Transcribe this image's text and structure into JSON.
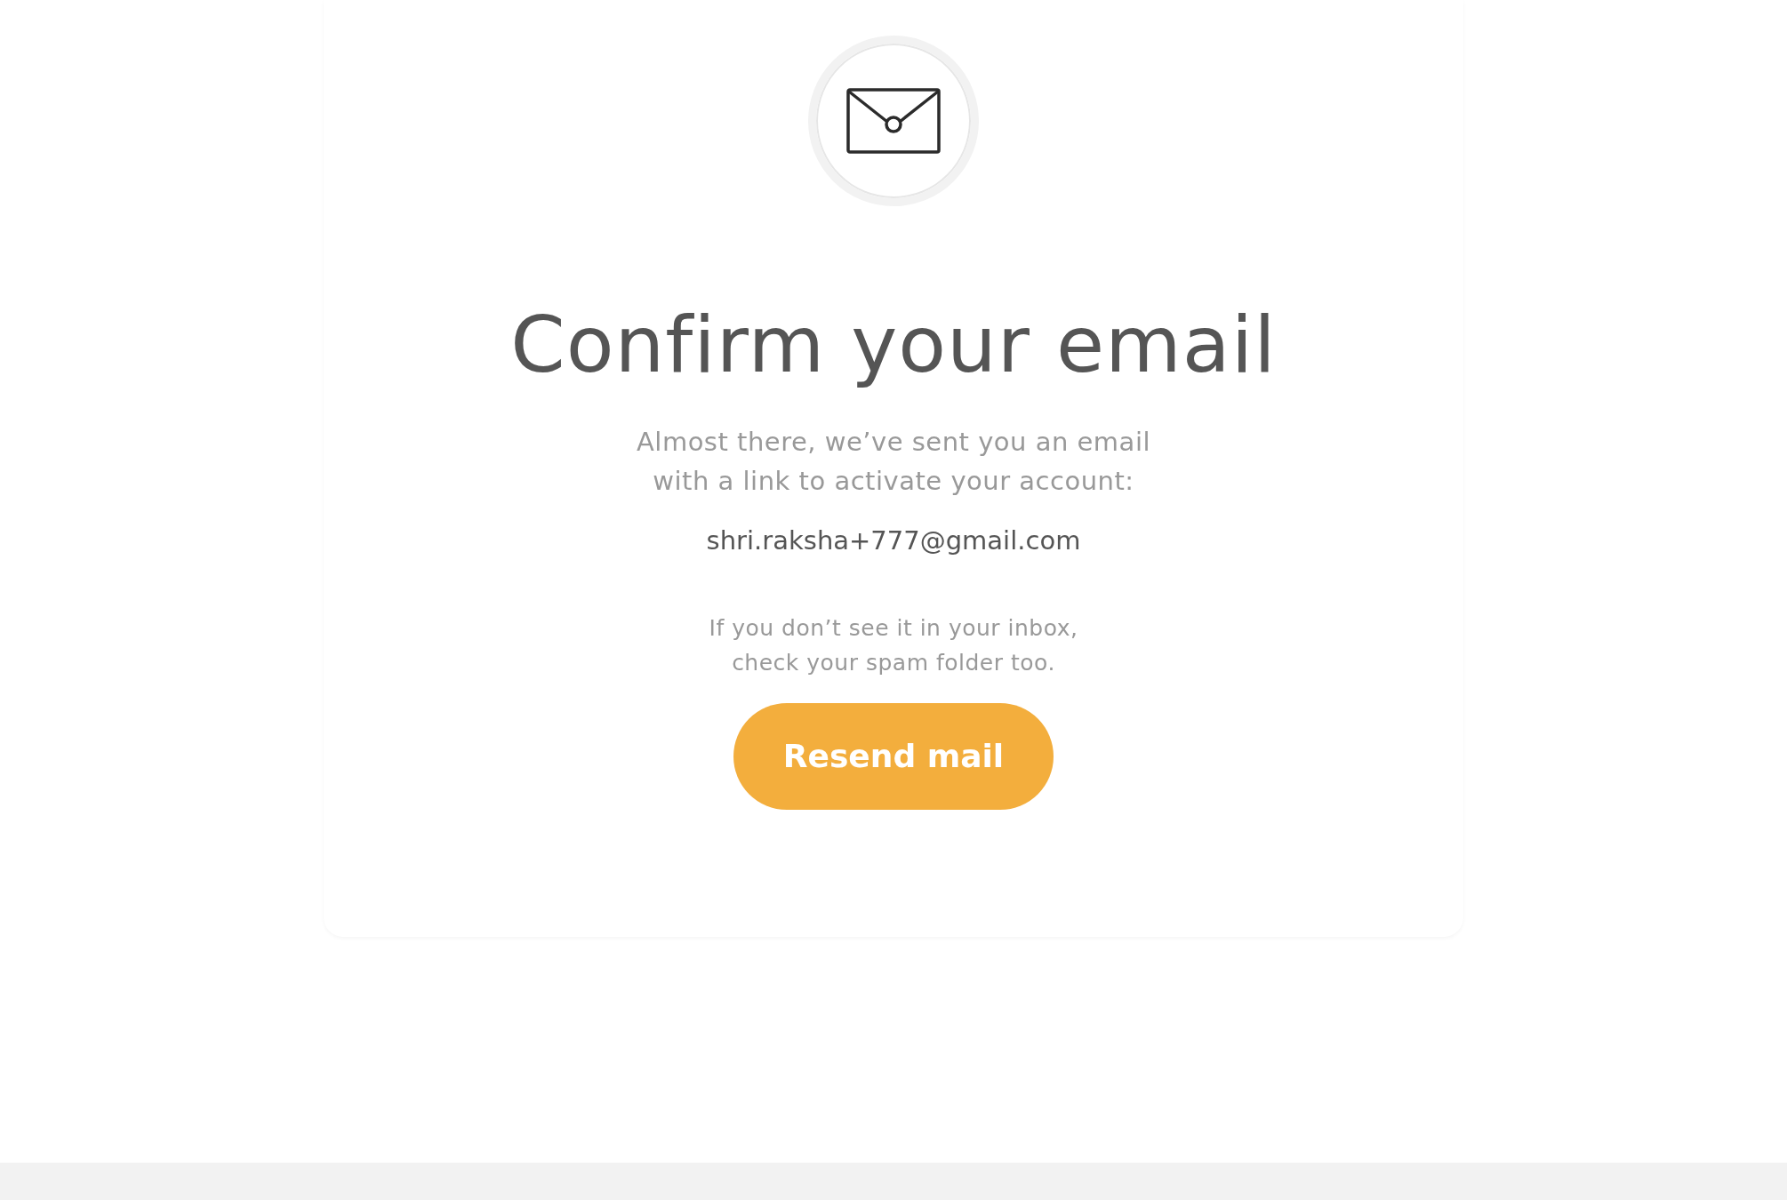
{
  "title": "Confirm your email",
  "message": [
    "Almost there, we’ve sent you an email",
    "with a link to activate your account:"
  ],
  "email": "shri.raksha+777@gmail.com",
  "hint": [
    "If you don’t see it in your inbox,",
    "check your spam folder too."
  ],
  "button": {
    "label": "Resend mail"
  }
}
